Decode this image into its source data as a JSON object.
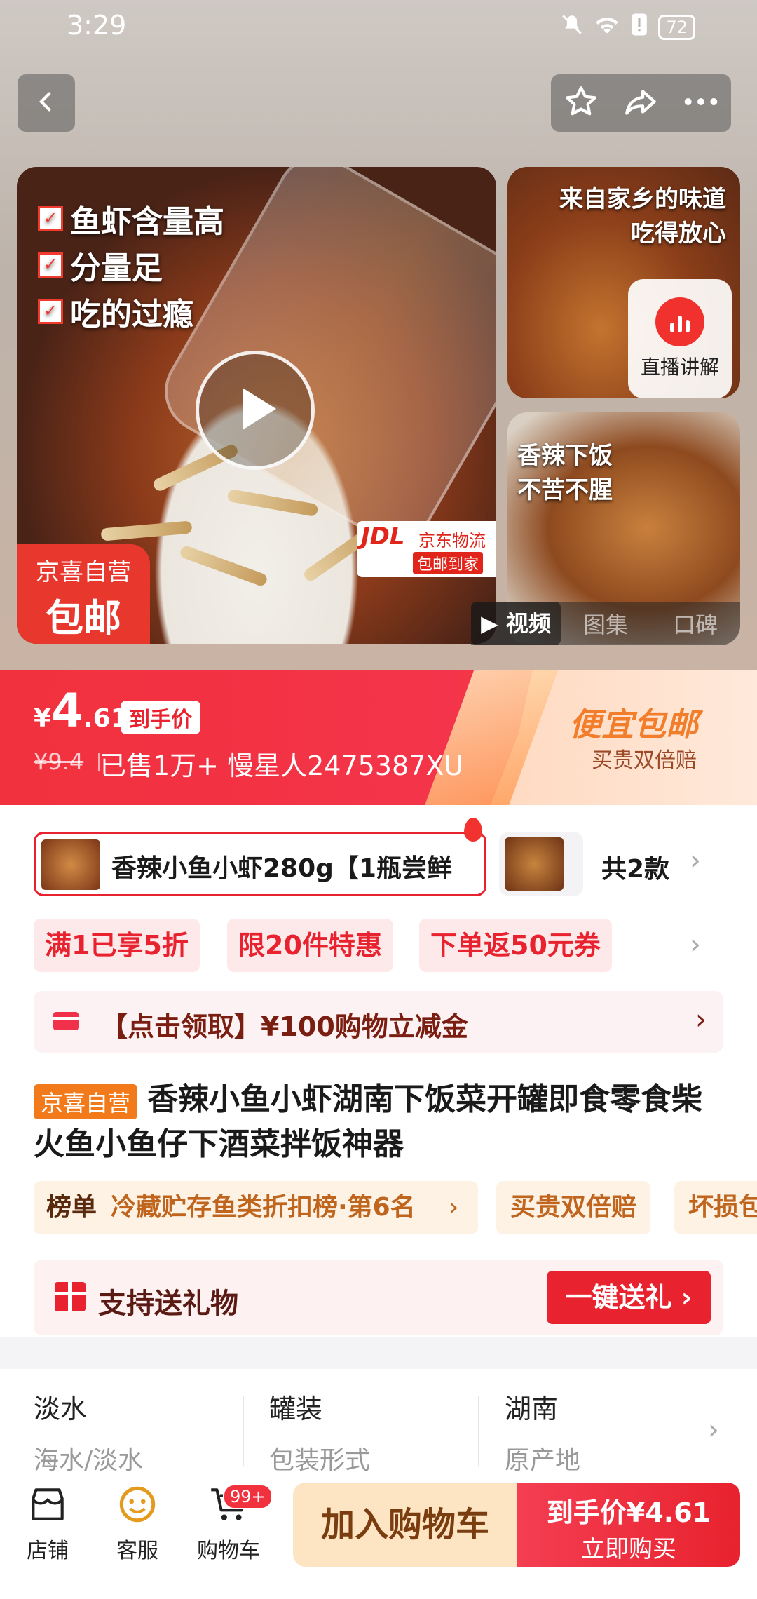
{
  "status_bar": {
    "time": "3:29",
    "battery": "72"
  },
  "gallery": {
    "features": [
      "鱼虾含量高",
      "分量足",
      "吃的过瘾"
    ],
    "jx_badge": {
      "line1": "京喜自营",
      "line2": "包邮"
    },
    "jdl_badge": {
      "logo": "JDL",
      "name": "京东物流",
      "slogan": "包邮到家"
    },
    "side1_text": [
      "来自家乡的味道",
      "吃得放心"
    ],
    "side2_text": [
      "香辣下饭",
      "不苦不腥"
    ],
    "live_label": "直播讲解",
    "media_tabs": [
      "视频",
      "图集",
      "口碑"
    ]
  },
  "price": {
    "currency": "¥",
    "integer": "4",
    "decimal": ".61",
    "tag": "到手价",
    "original": "¥9.4",
    "sold_text": "已售1万+ 慢星人2475387XU",
    "promo_title": "便宜包邮",
    "promo_sub": "买贵双倍赔"
  },
  "sku": {
    "selected_name": "香辣小鱼小虾280g【1瓶尝鲜",
    "count": "共2款"
  },
  "coupons": [
    "满1已享5折",
    "限20件特惠",
    "下单返50元券"
  ],
  "subsidy": "【点击领取】¥100购物立减金",
  "product": {
    "badge": "京喜自营",
    "title": "香辣小鱼小虾湖南下饭菜开罐即食零食柴火鱼小鱼仔下酒菜拌饭神器"
  },
  "rank": {
    "key": "榜单",
    "value": "冷藏贮存鱼类折扣榜·第6名",
    "chevron": "›"
  },
  "guarantees": [
    "买贵双倍赔",
    "坏损包"
  ],
  "gift": {
    "text": "支持送礼物",
    "button": "一键送礼 ›"
  },
  "attributes": [
    {
      "value": "淡水",
      "key": "海水/淡水"
    },
    {
      "value": "罐装",
      "key": "包装形式"
    },
    {
      "value": "湖南",
      "key": "原产地"
    }
  ],
  "bottom_nav": {
    "store": "店铺",
    "service": "客服",
    "cart": "购物车",
    "cart_badge": "99+",
    "add_cart": "加入购物车",
    "buy_line1": "到手价¥4.61",
    "buy_line2": "立即购买"
  },
  "colors": {
    "brand_red": "#e8222e",
    "accent_orange": "#f27a1a"
  }
}
